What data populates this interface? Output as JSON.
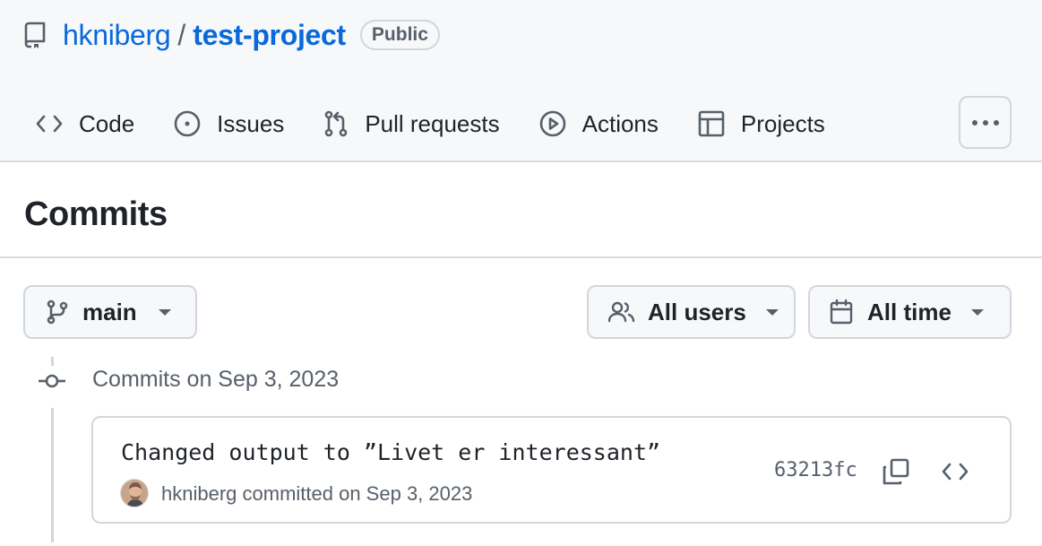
{
  "repo": {
    "owner": "hkniberg",
    "separator": "/",
    "name": "test-project",
    "visibility": "Public"
  },
  "tabs": [
    {
      "label": "Code",
      "icon": "code-icon"
    },
    {
      "label": "Issues",
      "icon": "issue-circle-icon"
    },
    {
      "label": "Pull requests",
      "icon": "pull-request-icon"
    },
    {
      "label": "Actions",
      "icon": "play-circle-icon"
    },
    {
      "label": "Projects",
      "icon": "table-icon"
    }
  ],
  "page": {
    "title": "Commits"
  },
  "filters": {
    "branch": "main",
    "users": "All users",
    "time": "All time"
  },
  "commit_groups": [
    {
      "date_label": "Commits on Sep 3, 2023",
      "commits": [
        {
          "message": "Changed output to ”Livet er interessant”",
          "author": "hkniberg",
          "meta": "committed on Sep 3, 2023",
          "sha": "63213fc"
        }
      ]
    }
  ],
  "colors": {
    "link": "#0969da",
    "header_bg": "#f6f8fa",
    "border": "#d0d7de",
    "muted_text": "#57606a"
  }
}
